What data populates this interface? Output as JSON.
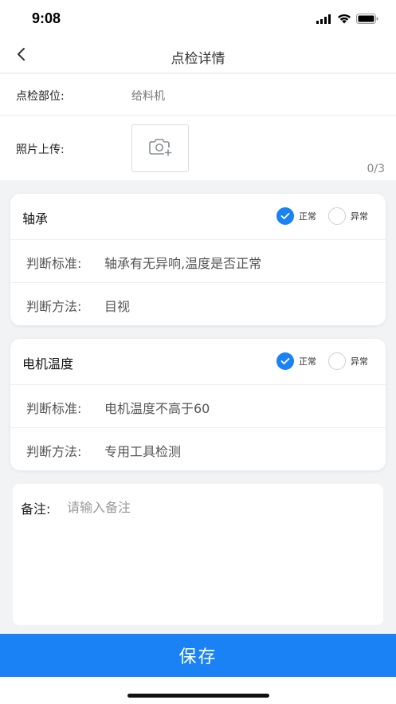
{
  "status": {
    "time": "9:08"
  },
  "nav": {
    "title": "点检详情"
  },
  "info": {
    "location_label": "点检部位:",
    "location_value": "给料机",
    "photo_label": "照片上传:",
    "photo_count": "0/3"
  },
  "items": [
    {
      "title": "轴承",
      "normal_label": "正常",
      "abnormal_label": "异常",
      "standard_label": "判断标准:",
      "standard_value": "轴承有无异响,温度是否正常",
      "method_label": "判断方法:",
      "method_value": "目视"
    },
    {
      "title": "电机温度",
      "normal_label": "正常",
      "abnormal_label": "异常",
      "standard_label": "判断标准:",
      "standard_value": "电机温度不高于60",
      "method_label": "判断方法:",
      "method_value": "专用工具检测"
    }
  ],
  "notes": {
    "label": "备注:",
    "placeholder": "请输入备注",
    "value": ""
  },
  "save_label": "保存",
  "colors": {
    "accent": "#1a82f5",
    "background": "#f2f3f5"
  },
  "icons": [
    "signal-icon",
    "wifi-icon",
    "battery-icon",
    "back-chevron-icon",
    "camera-add-icon",
    "check-icon"
  ]
}
